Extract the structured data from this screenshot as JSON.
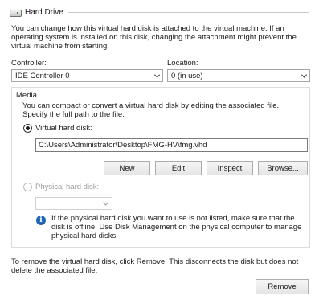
{
  "header": {
    "title": "Hard Drive",
    "icon": "hard-drive-icon"
  },
  "description": "You can change how this virtual hard disk is attached to the virtual machine. If an operating system is installed on this disk, changing the attachment might prevent the virtual machine from starting.",
  "controller": {
    "label": "Controller:",
    "value": "IDE Controller 0"
  },
  "location": {
    "label": "Location:",
    "value": "0 (in use)"
  },
  "media": {
    "title": "Media",
    "description": "You can compact or convert a virtual hard disk by editing the associated file. Specify the full path to the file.",
    "virtual_disk": {
      "label": "Virtual hard disk:",
      "selected": true,
      "path": "C:\\Users\\Administrator\\Desktop\\FMG-HV\\fmg.vhd"
    },
    "buttons": {
      "new": "New",
      "edit": "Edit",
      "inspect": "Inspect",
      "browse": "Browse..."
    },
    "physical_disk": {
      "label": "Physical hard disk:",
      "selected": false,
      "value": ""
    },
    "info": "If the physical hard disk you want to use is not listed, make sure that the disk is offline. Use Disk Management on the physical computer to manage physical hard disks."
  },
  "remove_description": "To remove the virtual hard disk, click Remove. This disconnects the disk but does not delete the associated file.",
  "remove_button": "Remove",
  "colors": {
    "info_icon": "#1f64b5",
    "disabled_text": "#9a9a9a",
    "border": "#a6a6a6"
  }
}
